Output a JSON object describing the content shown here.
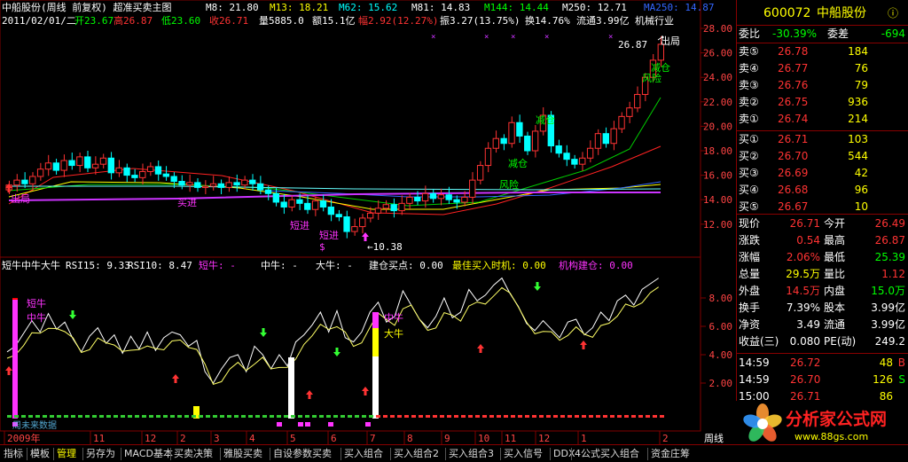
{
  "header": {
    "title": "中船股份(周线 前复权) 超准买卖主图",
    "ma": [
      {
        "label": "M8: 21.80",
        "color": "#ffffff"
      },
      {
        "label": "M13: 18.21",
        "color": "#ffff00"
      },
      {
        "label": "M62: 15.62",
        "color": "#00ffff"
      },
      {
        "label": "M81: 14.83",
        "color": "#ffffff"
      },
      {
        "label": "M144: 14.44",
        "color": "#00ff00"
      },
      {
        "label": "M250: 12.71",
        "color": "#ffffff"
      },
      {
        "label": "MA250: 14.87",
        "color": "#3366ff"
      }
    ],
    "info": [
      {
        "label": "2011/02/01/二",
        "color": "#ffffff"
      },
      {
        "label": "开23.67",
        "color": "#00ff00"
      },
      {
        "label": "高26.87",
        "color": "#ff3333"
      },
      {
        "label": "低23.60",
        "color": "#00ff00"
      },
      {
        "label": "收26.71",
        "color": "#ff3333"
      },
      {
        "label": "量5885.0",
        "color": "#ffffff"
      },
      {
        "label": "额15.1亿",
        "color": "#ffffff"
      },
      {
        "label": "幅2.92(12.27%)",
        "color": "#ff3333"
      },
      {
        "label": "振3.27(13.75%)",
        "color": "#ffffff"
      },
      {
        "label": "换14.76%",
        "color": "#ffffff"
      },
      {
        "label": "流通3.99亿",
        "color": "#ffffff"
      },
      {
        "label": "机械行业",
        "color": "#ffffff"
      }
    ]
  },
  "main_labels": {
    "high_price": "26.87",
    "low_price": "←10.38",
    "exit": "出局",
    "reduce1": "减仓",
    "risk1": "风险",
    "reduce2": "减仓",
    "reduce3": "减仓",
    "risk2": "风险",
    "out_low": "出局",
    "buy_entry": "买进",
    "short_entry": "短进",
    "short_entry2": "短进",
    "dollar": "$"
  },
  "main_axis": [
    "28.00",
    "26.00",
    "24.00",
    "22.00",
    "20.00",
    "18.00",
    "16.00",
    "14.00",
    "12.00"
  ],
  "indicator": {
    "title": "短牛中牛大牛",
    "items": [
      {
        "label": "RSI15: 9.33",
        "color": "#ffffff"
      },
      {
        "label": "RSI10: 8.47",
        "color": "#ffffff"
      },
      {
        "label": "短牛: -",
        "color": "#ff33ff"
      },
      {
        "label": "中牛: -",
        "color": "#ffffff"
      },
      {
        "label": "大牛: -",
        "color": "#ffffff"
      },
      {
        "label": "建仓买点: 0.00",
        "color": "#ffffff"
      },
      {
        "label": "最佳买入时机: 0.00",
        "color": "#ffff00"
      },
      {
        "label": "机构建仓: 0.00",
        "color": "#ff33ff"
      }
    ],
    "axis": [
      "8.00",
      "6.00",
      "4.00",
      "2.00"
    ],
    "tags": {
      "short": "短牛",
      "mid": "中牛",
      "mid2": "中牛",
      "big": "大牛"
    },
    "bottom_text": "周未来数据"
  },
  "time_axis": {
    "labels": [
      "2009年",
      "11",
      "12",
      "2",
      "3",
      "4",
      "5",
      "6",
      "7",
      "8",
      "9",
      "10",
      "11",
      "12",
      "1",
      "2"
    ],
    "period": "周线"
  },
  "quote": {
    "code": "600072",
    "name": "中船股份",
    "webi_label": "委比",
    "webi": "-30.39%",
    "weicha_label": "委差",
    "weicha": "-694",
    "asks": [
      {
        "label": "卖⑤",
        "price": "26.78",
        "vol": "184"
      },
      {
        "label": "卖④",
        "price": "26.77",
        "vol": "76"
      },
      {
        "label": "卖③",
        "price": "26.76",
        "vol": "79"
      },
      {
        "label": "卖②",
        "price": "26.75",
        "vol": "936"
      },
      {
        "label": "卖①",
        "price": "26.74",
        "vol": "214"
      }
    ],
    "bids": [
      {
        "label": "买①",
        "price": "26.71",
        "vol": "103"
      },
      {
        "label": "买②",
        "price": "26.70",
        "vol": "544"
      },
      {
        "label": "买③",
        "price": "26.69",
        "vol": "42"
      },
      {
        "label": "买④",
        "price": "26.68",
        "vol": "96"
      },
      {
        "label": "买⑤",
        "price": "26.67",
        "vol": "10"
      }
    ],
    "stats": [
      {
        "l1": "现价",
        "v1": "26.71",
        "c1": "#ff3333",
        "l2": "今开",
        "v2": "26.49",
        "c2": "#ff3333"
      },
      {
        "l1": "涨跌",
        "v1": "0.54",
        "c1": "#ff3333",
        "l2": "最高",
        "v2": "26.87",
        "c2": "#ff3333"
      },
      {
        "l1": "涨幅",
        "v1": "2.06%",
        "c1": "#ff3333",
        "l2": "最低",
        "v2": "25.39",
        "c2": "#00ff00"
      },
      {
        "l1": "总量",
        "v1": "29.5万",
        "c1": "#ffff00",
        "l2": "量比",
        "v2": "1.12",
        "c2": "#ff3333"
      },
      {
        "l1": "外盘",
        "v1": "14.5万",
        "c1": "#ff3333",
        "l2": "内盘",
        "v2": "15.0万",
        "c2": "#00ff00"
      },
      {
        "l1": "换手",
        "v1": "7.39%",
        "c1": "#ffffff",
        "l2": "股本",
        "v2": "3.99亿",
        "c2": "#ffffff"
      },
      {
        "l1": "净资",
        "v1": "3.49",
        "c1": "#ffffff",
        "l2": "流通",
        "v2": "3.99亿",
        "c2": "#ffffff"
      },
      {
        "l1": "收益(三)",
        "v1": "0.080",
        "c1": "#ffffff",
        "l2": "PE(动)",
        "v2": "249.2",
        "c2": "#ffffff"
      }
    ],
    "ticks": [
      {
        "time": "14:59",
        "price": "26.72",
        "vol": "48",
        "flag": "B",
        "fc": "#ff3333"
      },
      {
        "time": "14:59",
        "price": "26.70",
        "vol": "126",
        "flag": "S",
        "fc": "#00ff00"
      },
      {
        "time": "15:00",
        "price": "26.71",
        "vol": "86",
        "flag": "",
        "fc": "#ffff00"
      },
      {
        "time": "15:00",
        "price": "26.71",
        "vol": "137",
        "flag": "S",
        "fc": "#00ff00"
      }
    ]
  },
  "watermark": {
    "site": "分析家公式网",
    "url": "www.88gs.com"
  },
  "tabs": [
    "指标",
    "模板",
    "管理",
    "另存为",
    "MACD基本",
    "买卖决策",
    "雅股买卖",
    "自设参数买卖",
    "买入组合",
    "买入组合2",
    "买入组合3",
    "买入信号",
    "DDX",
    "4公式买入组合",
    "资金庄筹"
  ],
  "colors": {
    "up": "#ff3333",
    "down": "#00ffff",
    "accent": "#ffff00"
  }
}
